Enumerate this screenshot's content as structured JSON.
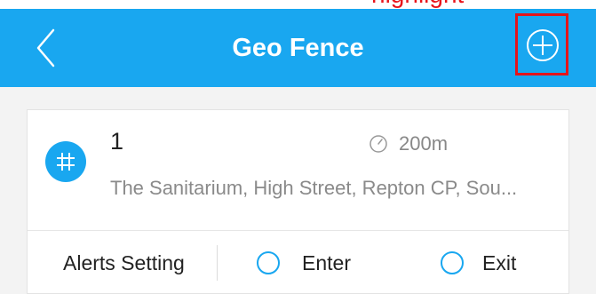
{
  "header": {
    "title": "Geo Fence",
    "top_annotation": "highlight",
    "icons": {
      "back": "chevron-left-icon",
      "add": "plus-circle-icon"
    }
  },
  "fence": {
    "name": "1",
    "radius": "200m",
    "address": "The Sanitarium, High Street, Repton CP, Sou...",
    "icons": {
      "fence": "fence-icon",
      "radius": "clock-radius-icon"
    }
  },
  "alerts": {
    "label": "Alerts Setting",
    "enter_label": "Enter",
    "exit_label": "Exit",
    "enter_checked": false,
    "exit_checked": false
  },
  "colors": {
    "accent": "#19a7f0",
    "highlight": "#e4141b",
    "background": "#f3f3f3"
  }
}
